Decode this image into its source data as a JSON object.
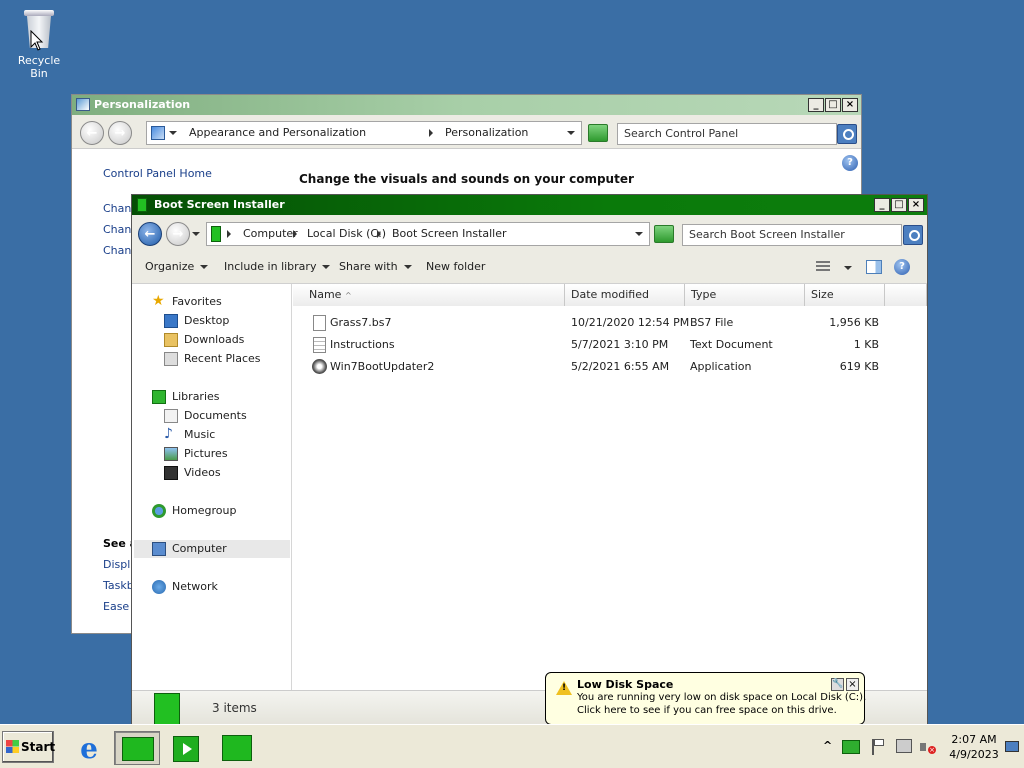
{
  "desktop": {
    "recycle_bin_label": "Recycle Bin"
  },
  "personalization": {
    "title": "Personalization",
    "breadcrumb": [
      "Appearance and Personalization",
      "Personalization"
    ],
    "search_placeholder": "Search Control Panel",
    "sidebar_home": "Control Panel Home",
    "sidebar_links_truncated": [
      "Chan",
      "Chan",
      "Chan"
    ],
    "see_also_heading": "See a",
    "see_also_links_truncated": [
      "Displ",
      "Taskb",
      "Ease"
    ],
    "heading": "Change the visuals and sounds on your computer"
  },
  "explorer": {
    "title": "Boot Screen Installer",
    "breadcrumb": [
      "Computer",
      "Local Disk (C:)",
      "Boot Screen Installer"
    ],
    "search_placeholder": "Search Boot Screen Installer",
    "toolbar": {
      "organize": "Organize",
      "include_in_library": "Include in library",
      "share_with": "Share with",
      "new_folder": "New folder"
    },
    "nav": {
      "favorites": "Favorites",
      "desktop": "Desktop",
      "downloads": "Downloads",
      "recent_places": "Recent Places",
      "libraries": "Libraries",
      "documents": "Documents",
      "music": "Music",
      "pictures": "Pictures",
      "videos": "Videos",
      "homegroup": "Homegroup",
      "computer": "Computer",
      "network": "Network"
    },
    "columns": {
      "name": "Name",
      "date_modified": "Date modified",
      "type": "Type",
      "size": "Size"
    },
    "files": [
      {
        "name": "Grass7.bs7",
        "date": "10/21/2020 12:54 PM",
        "type": "BS7 File",
        "size": "1,956 KB",
        "icon": "file-icon"
      },
      {
        "name": "Instructions",
        "date": "5/7/2021 3:10 PM",
        "type": "Text Document",
        "size": "1 KB",
        "icon": "text-file-icon"
      },
      {
        "name": "Win7BootUpdater2",
        "date": "5/2/2021 6:55 AM",
        "type": "Application",
        "size": "619 KB",
        "icon": "app-icon"
      }
    ],
    "status": "3 items"
  },
  "notification": {
    "title": "Low Disk Space",
    "line1": "You are running very low on disk space on Local Disk (C:).",
    "line2": "Click here to see if you can free space on this drive."
  },
  "taskbar": {
    "start_label": "Start",
    "time": "2:07 AM",
    "date": "4/9/2023"
  },
  "colors": {
    "desktop": "#3a6ea5",
    "personalization_title_bar": "#8fbc8f",
    "explorer_title_bar": "#0b6b0b",
    "taskbar": "#ece9d8",
    "balloon": "#ffffe1"
  }
}
